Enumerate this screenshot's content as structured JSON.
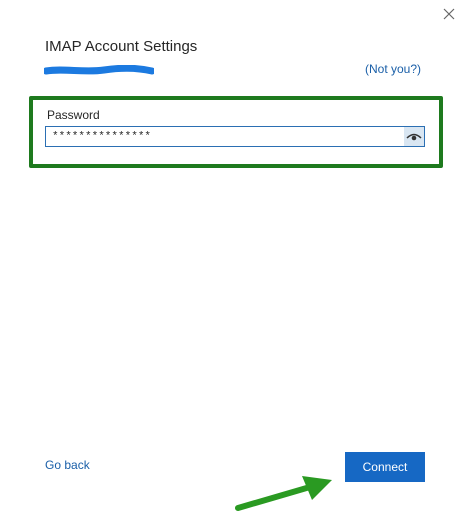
{
  "dialog": {
    "title": "IMAP Account Settings",
    "not_you_label": "(Not you?)"
  },
  "password": {
    "label": "Password",
    "value": "***************"
  },
  "footer": {
    "go_back_label": "Go back",
    "connect_label": "Connect"
  },
  "colors": {
    "accent": "#1668c4",
    "link": "#1a5fa8",
    "highlight": "#1e7a1e"
  },
  "icons": {
    "close": "close-icon",
    "reveal": "eye-icon",
    "annotation_arrow": "arrow-icon"
  }
}
